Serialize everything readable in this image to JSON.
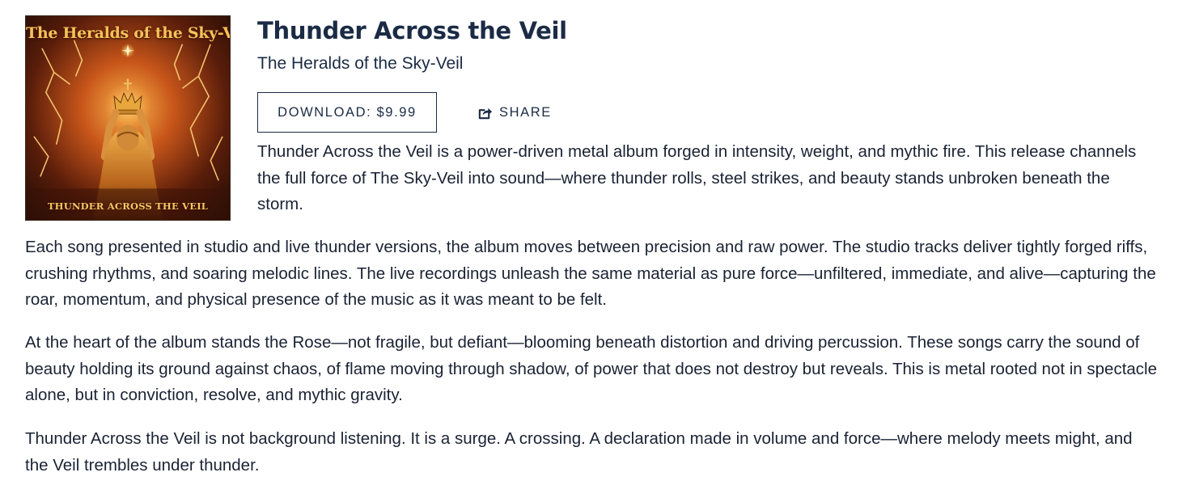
{
  "album": {
    "title": "Thunder Across the Veil",
    "artist": "The Heralds of the Sky-Veil",
    "cover": {
      "top_text": "The Heralds of the Sky-Veil",
      "bottom_text": "THUNDER ACROSS THE VEIL"
    }
  },
  "actions": {
    "download_label": "DOWNLOAD: $9.99",
    "share_label": "SHARE",
    "share_icon": "share-square-icon"
  },
  "description": {
    "intro": "Thunder Across the Veil is a power-driven metal album forged in intensity, weight, and mythic fire. This release channels the full force of The Sky-Veil into sound—where thunder rolls, steel strikes, and beauty stands unbroken beneath the storm.",
    "paragraphs": [
      "Each song presented in studio and live thunder versions, the album moves between precision and raw power. The studio tracks deliver tightly forged riffs, crushing rhythms, and soaring melodic lines. The live recordings unleash the same material as pure force—unfiltered, immediate, and alive—capturing the roar, momentum, and physical presence of the music as it was meant to be felt.",
      "At the heart of the album stands the Rose—not fragile, but defiant—blooming beneath distortion and driving percussion. These songs carry the sound of beauty holding its ground against chaos, of flame moving through shadow, of power that does not destroy but reveals. This is metal rooted not in spectacle alone, but in conviction, resolve, and mythic gravity.",
      "Thunder Across the Veil is not background listening. It is a surge. A crossing. A declaration made in volume and force—where melody meets might, and the Veil trembles under thunder."
    ]
  },
  "colors": {
    "text": "#1a2233",
    "heading": "#1b2b45",
    "cover_gold": "#f3c35a",
    "cover_fire": "#e0741a"
  }
}
